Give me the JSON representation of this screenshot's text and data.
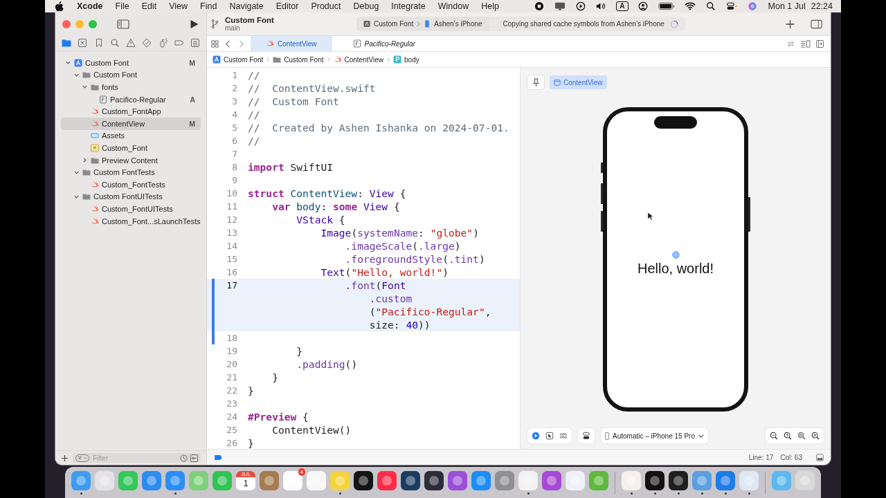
{
  "menu_bar": {
    "app": "Xcode",
    "menus": [
      "File",
      "Edit",
      "View",
      "Find",
      "Navigate",
      "Editor",
      "Product",
      "Debug",
      "Integrate",
      "Window",
      "Help"
    ],
    "input_source": "A",
    "date": "Mon 1 Jul",
    "time": "22:24"
  },
  "window": {
    "project": "Custom Font",
    "branch": "main",
    "scheme": {
      "target": "Custom Font",
      "device": "Ashen’s iPhone"
    },
    "activity": "Copying shared cache symbols from Ashen’s iPhone",
    "navigator_tabs": [
      {
        "kind": "files",
        "selected": true
      },
      {
        "kind": "source-control",
        "selected": false
      },
      {
        "kind": "bookmarks",
        "selected": false
      },
      {
        "kind": "search",
        "selected": false
      },
      {
        "kind": "issues",
        "selected": false
      },
      {
        "kind": "tests",
        "selected": false
      },
      {
        "kind": "debug",
        "selected": false
      },
      {
        "kind": "breakpoints",
        "selected": false
      },
      {
        "kind": "reports",
        "selected": false
      }
    ],
    "navigator": [
      {
        "label": "Custom Font",
        "kind": "project",
        "badge": "M",
        "expanded": true,
        "selected": false,
        "children": [
          {
            "label": "Custom Font",
            "kind": "folder",
            "expanded": true,
            "selected": false,
            "children": [
              {
                "label": "fonts",
                "kind": "folder",
                "expanded": true,
                "selected": false,
                "children": [
                  {
                    "label": "Pacifico-Regular",
                    "kind": "font",
                    "badge": "A",
                    "selected": false
                  }
                ]
              },
              {
                "label": "Custom_FontApp",
                "kind": "swift",
                "selected": false
              },
              {
                "label": "ContentView",
                "kind": "swift",
                "badge": "M",
                "selected": true
              },
              {
                "label": "Assets",
                "kind": "assets",
                "selected": false
              },
              {
                "label": "Custom_Font",
                "kind": "entitlements",
                "selected": false
              },
              {
                "label": "Preview Content",
                "kind": "folder",
                "expanded": false,
                "selected": false
              }
            ]
          },
          {
            "label": "Custom FontTests",
            "kind": "folder",
            "expanded": true,
            "selected": false,
            "children": [
              {
                "label": "Custom_FontTests",
                "kind": "swift",
                "selected": false
              }
            ]
          },
          {
            "label": "Custom FontUITests",
            "kind": "folder",
            "expanded": true,
            "selected": false,
            "children": [
              {
                "label": "Custom_FontUITests",
                "kind": "swift",
                "selected": false
              },
              {
                "label": "Custom_Font...sLaunchTests",
                "kind": "swift",
                "selected": false
              }
            ]
          }
        ]
      }
    ],
    "filter": {
      "placeholder": "Filter"
    },
    "editor_tabs": [
      {
        "label": "ContentView",
        "kind": "swift",
        "selected": true,
        "preview": false
      },
      {
        "label": "Pacifico-Regular",
        "kind": "font",
        "selected": false,
        "preview": true
      }
    ],
    "jump_bar": [
      {
        "label": "Custom Font",
        "kind": "project"
      },
      {
        "label": "Custom Font",
        "kind": "folder"
      },
      {
        "label": "ContentView",
        "kind": "swift"
      },
      {
        "label": "body",
        "kind": "property"
      }
    ],
    "code_lines": [
      {
        "number": "1",
        "current": false,
        "changed": false,
        "rows": [
          {
            "tokens": [
              {
                "kind": "comment",
                "text": "//"
              }
            ]
          }
        ]
      },
      {
        "number": "2",
        "current": false,
        "changed": false,
        "rows": [
          {
            "tokens": [
              {
                "kind": "comment",
                "text": "//  ContentView.swift"
              }
            ]
          }
        ]
      },
      {
        "number": "3",
        "current": false,
        "changed": false,
        "rows": [
          {
            "tokens": [
              {
                "kind": "comment",
                "text": "//  Custom Font"
              }
            ]
          }
        ]
      },
      {
        "number": "4",
        "current": false,
        "changed": false,
        "rows": [
          {
            "tokens": [
              {
                "kind": "comment",
                "text": "//"
              }
            ]
          }
        ]
      },
      {
        "number": "5",
        "current": false,
        "changed": false,
        "rows": [
          {
            "tokens": [
              {
                "kind": "comment",
                "text": "//  Created by Ashen Ishanka on 2024-07-01."
              }
            ]
          }
        ]
      },
      {
        "number": "6",
        "current": false,
        "changed": false,
        "rows": [
          {
            "tokens": [
              {
                "kind": "comment",
                "text": "//"
              }
            ]
          }
        ]
      },
      {
        "number": "7",
        "current": false,
        "changed": false
      },
      {
        "number": "8",
        "current": false,
        "changed": false,
        "rows": [
          {
            "tokens": [
              {
                "kind": "keyword",
                "text": "import"
              },
              {
                "kind": "plain",
                "text": " SwiftUI"
              }
            ]
          }
        ]
      },
      {
        "number": "9",
        "current": false,
        "changed": false
      },
      {
        "number": "10",
        "current": false,
        "changed": false,
        "rows": [
          {
            "tokens": [
              {
                "kind": "keyword",
                "text": "struct"
              },
              {
                "kind": "decl",
                "text": " ContentView"
              },
              {
                "kind": "plain",
                "text": ":"
              },
              {
                "kind": "type",
                "text": " View"
              },
              {
                "kind": "plain",
                "text": " {"
              }
            ]
          }
        ]
      },
      {
        "number": "11",
        "current": false,
        "changed": false,
        "rows": [
          {
            "tokens": [
              {
                "kind": "keyword",
                "text": "    var"
              },
              {
                "kind": "decl",
                "text": " body"
              },
              {
                "kind": "plain",
                "text": ":"
              },
              {
                "kind": "keyword",
                "text": " some"
              },
              {
                "kind": "type",
                "text": " View"
              },
              {
                "kind": "plain",
                "text": " {"
              }
            ]
          }
        ]
      },
      {
        "number": "12",
        "current": false,
        "changed": false,
        "rows": [
          {
            "tokens": [
              {
                "kind": "type",
                "text": "        VStack"
              },
              {
                "kind": "plain",
                "text": " {"
              }
            ]
          }
        ]
      },
      {
        "number": "13",
        "current": false,
        "changed": false,
        "rows": [
          {
            "tokens": [
              {
                "kind": "type",
                "text": "            Image"
              },
              {
                "kind": "plain",
                "text": "("
              },
              {
                "kind": "member",
                "text": "systemName"
              },
              {
                "kind": "plain",
                "text": ":"
              },
              {
                "kind": "string",
                "text": " \"globe\""
              },
              {
                "kind": "plain",
                "text": ")"
              }
            ]
          }
        ]
      },
      {
        "number": "14",
        "current": false,
        "changed": false,
        "rows": [
          {
            "tokens": [
              {
                "kind": "member",
                "text": "                .imageScale"
              },
              {
                "kind": "plain",
                "text": "("
              },
              {
                "kind": "member",
                "text": ".large"
              },
              {
                "kind": "plain",
                "text": ")"
              }
            ]
          }
        ]
      },
      {
        "number": "15",
        "current": false,
        "changed": false,
        "rows": [
          {
            "tokens": [
              {
                "kind": "member",
                "text": "                .foregroundStyle"
              },
              {
                "kind": "plain",
                "text": "("
              },
              {
                "kind": "member",
                "text": ".tint"
              },
              {
                "kind": "plain",
                "text": ")"
              }
            ]
          }
        ]
      },
      {
        "number": "16",
        "current": false,
        "changed": false,
        "rows": [
          {
            "tokens": [
              {
                "kind": "type",
                "text": "            Text"
              },
              {
                "kind": "plain",
                "text": "("
              },
              {
                "kind": "string",
                "text": "\"Hello, world!\""
              },
              {
                "kind": "plain",
                "text": ")"
              }
            ]
          }
        ]
      },
      {
        "number": "17",
        "current": true,
        "changed": true,
        "rows": [
          {
            "tokens": [
              {
                "kind": "member",
                "text": "                .font"
              },
              {
                "kind": "plain",
                "text": "("
              },
              {
                "kind": "type",
                "text": "Font"
              }
            ]
          },
          {
            "tokens": [
              {
                "kind": "member",
                "text": "                    .custom"
              }
            ]
          },
          {
            "tokens": [
              {
                "kind": "plain",
                "text": "                    ("
              },
              {
                "kind": "string",
                "text": "\"Pacifico-Regular\""
              },
              {
                "kind": "plain",
                "text": ","
              }
            ]
          },
          {
            "tokens": [
              {
                "kind": "plain",
                "text": "                    size:"
              },
              {
                "kind": "number",
                "text": " 40"
              },
              {
                "kind": "plain",
                "text": "))"
              }
            ]
          }
        ]
      },
      {
        "number": "18",
        "current": false,
        "changed": true
      },
      {
        "number": "19",
        "current": false,
        "changed": false,
        "rows": [
          {
            "tokens": [
              {
                "kind": "plain",
                "text": "        }"
              }
            ]
          }
        ]
      },
      {
        "number": "20",
        "current": false,
        "changed": false,
        "rows": [
          {
            "tokens": [
              {
                "kind": "member",
                "text": "        .padding"
              },
              {
                "kind": "plain",
                "text": "()"
              }
            ]
          }
        ]
      },
      {
        "number": "21",
        "current": false,
        "changed": false,
        "rows": [
          {
            "tokens": [
              {
                "kind": "plain",
                "text": "    }"
              }
            ]
          }
        ]
      },
      {
        "number": "22",
        "current": false,
        "changed": false,
        "rows": [
          {
            "tokens": [
              {
                "kind": "plain",
                "text": "}"
              }
            ]
          }
        ]
      },
      {
        "number": "23",
        "current": false,
        "changed": false
      },
      {
        "number": "24",
        "current": false,
        "changed": false,
        "rows": [
          {
            "tokens": [
              {
                "kind": "keyword",
                "text": "#Preview"
              },
              {
                "kind": "plain",
                "text": " {"
              }
            ]
          }
        ]
      },
      {
        "number": "25",
        "current": false,
        "changed": false,
        "rows": [
          {
            "tokens": [
              {
                "kind": "plain",
                "text": "    ContentView()"
              }
            ]
          }
        ]
      },
      {
        "number": "26",
        "current": false,
        "changed": false,
        "rows": [
          {
            "tokens": [
              {
                "kind": "plain",
                "text": "}"
              }
            ]
          }
        ]
      }
    ],
    "canvas": {
      "preview_name": "ContentView",
      "greeting": "Hello, world!",
      "device": "Automatic – iPhone 15 Pro"
    },
    "status_bar": {
      "line": "Line: 17",
      "column": "Col: 63"
    }
  },
  "dock": [
    {
      "kind": "app",
      "color": "#3d9cf0",
      "running": true
    },
    {
      "kind": "app",
      "color": "#e4e4e8",
      "running": false
    },
    {
      "kind": "app",
      "color": "#34c759",
      "running": false
    },
    {
      "kind": "app",
      "color": "#2d8cf0",
      "running": false
    },
    {
      "kind": "app",
      "color": "#2a8ff5",
      "running": true
    },
    {
      "kind": "app",
      "color": "#7fd07a",
      "running": false
    },
    {
      "kind": "app",
      "color": "#30c452",
      "running": false
    },
    {
      "kind": "calendar",
      "month": "JUL",
      "day": "1",
      "running": false
    },
    {
      "kind": "app",
      "color": "#a57c4f",
      "running": false
    },
    {
      "kind": "app",
      "color": "#fdfdfd",
      "badge": "4",
      "running": false
    },
    {
      "kind": "app",
      "color": "#f7f7f7",
      "running": false
    },
    {
      "kind": "app",
      "color": "#f5d33b",
      "running": true
    },
    {
      "kind": "app",
      "color": "#151515",
      "running": false
    },
    {
      "kind": "app",
      "color": "#fa2d48",
      "running": false
    },
    {
      "kind": "app",
      "color": "#1c3d63",
      "running": false
    },
    {
      "kind": "app",
      "color": "#2b2b3a",
      "running": false
    },
    {
      "kind": "app",
      "color": "#9b4fd8",
      "running": false
    },
    {
      "kind": "app",
      "color": "#1e8cf5",
      "running": false
    },
    {
      "kind": "app",
      "color": "#8e8e93",
      "running": false
    },
    {
      "kind": "app",
      "color": "#f2f2f2",
      "running": true
    },
    {
      "kind": "app",
      "color": "#a64ad6",
      "running": false
    },
    {
      "kind": "app",
      "color": "#eef2f8",
      "running": false
    },
    {
      "kind": "app",
      "color": "#5fb93d",
      "running": false
    },
    {
      "kind": "separator"
    },
    {
      "kind": "app",
      "color": "#f4f0ee",
      "running": true
    },
    {
      "kind": "app",
      "color": "#111111",
      "running": true
    },
    {
      "kind": "app",
      "color": "#1f1f1f",
      "running": true
    },
    {
      "kind": "app",
      "color": "#5a9fe0",
      "running": true
    },
    {
      "kind": "app",
      "color": "#1e7ce8",
      "running": true
    },
    {
      "kind": "app",
      "color": "#dfe9f5",
      "running": true
    },
    {
      "kind": "separator"
    },
    {
      "kind": "app",
      "color": "#5bb8f0",
      "running": false
    },
    {
      "kind": "app",
      "color": "#d9d9d9",
      "running": false
    }
  ]
}
